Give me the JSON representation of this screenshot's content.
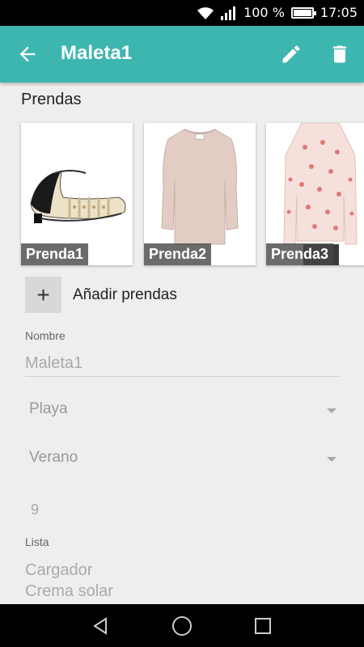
{
  "status_bar": {
    "battery_percent": "100 %",
    "time": "17:05"
  },
  "app_bar": {
    "title": "Maleta1",
    "color": "#3db6b0",
    "icons": [
      "arrow-back-icon",
      "pencil-icon",
      "trash-icon"
    ]
  },
  "section": {
    "title": "Prendas"
  },
  "garments": [
    {
      "label": "Prenda1",
      "image": "sandal"
    },
    {
      "label": "Prenda2",
      "image": "sweater"
    },
    {
      "label": "Prenda3",
      "image": "floral-shirt"
    }
  ],
  "add_garments": {
    "icon": "+",
    "label": "Añadir prendas"
  },
  "form": {
    "name_label": "Nombre",
    "name_value": "Maleta1",
    "destination": "Playa",
    "season": "Verano",
    "number": "9",
    "list_label": "Lista",
    "list_items": [
      "Cargador",
      "Crema solar"
    ]
  }
}
